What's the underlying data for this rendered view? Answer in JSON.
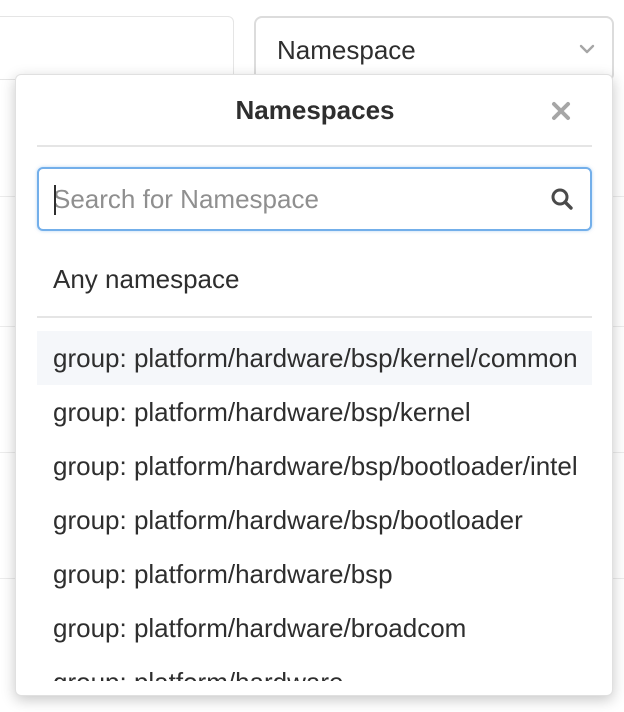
{
  "toggle": {
    "label": "Namespace",
    "icon": "chevron-down-icon"
  },
  "dropdown": {
    "title": "Namespaces",
    "close_icon": "close-icon",
    "search": {
      "placeholder": "Search for Namespace",
      "value": "",
      "icon": "search-icon"
    },
    "any_option": "Any namespace",
    "items": [
      {
        "label": "group: platform/hardware/bsp/kernel/common",
        "active": true
      },
      {
        "label": "group: platform/hardware/bsp/kernel",
        "active": false
      },
      {
        "label": "group: platform/hardware/bsp/bootloader/intel",
        "active": false
      },
      {
        "label": "group: platform/hardware/bsp/bootloader",
        "active": false
      },
      {
        "label": "group: platform/hardware/bsp",
        "active": false
      },
      {
        "label": "group: platform/hardware/broadcom",
        "active": false
      },
      {
        "label": "group: platform/hardware",
        "active": false
      }
    ]
  },
  "colors": {
    "focus_border": "#73afea",
    "active_row": "#f5f7fa",
    "text": "#2e2e2e",
    "placeholder": "#8f8f8f",
    "icon_gray": "#a6a6a6"
  }
}
